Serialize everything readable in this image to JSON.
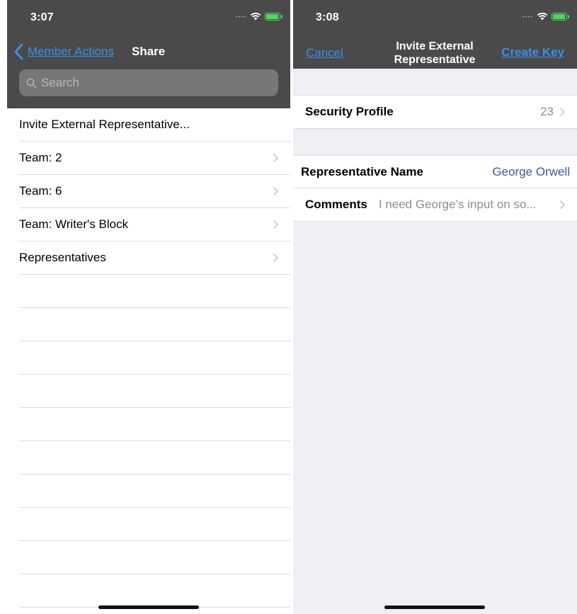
{
  "left": {
    "status_time": "3:07",
    "nav": {
      "back_label": "Member Actions",
      "title": "Share"
    },
    "search": {
      "placeholder": "Search"
    },
    "rows": [
      {
        "label": "Invite External Representative...",
        "has_chevron": false
      },
      {
        "label": "Team: 2",
        "has_chevron": true
      },
      {
        "label": "Team: 6",
        "has_chevron": true
      },
      {
        "label": "Team: Writer's Block",
        "has_chevron": true
      },
      {
        "label": "Representatives",
        "has_chevron": true
      }
    ]
  },
  "right": {
    "status_time": "3:08",
    "nav": {
      "cancel_label": "Cancel",
      "title_line1": "Invite External",
      "title_line2": "Representative",
      "create_key_label": "Create Key"
    },
    "security_profile": {
      "label": "Security Profile",
      "value": "23"
    },
    "representative_name": {
      "label": "Representative Name",
      "value": "George Orwell"
    },
    "comments": {
      "label": "Comments",
      "value": "I need George’s input on so..."
    }
  },
  "colors": {
    "nav_background": "#4a4a4a",
    "link_blue": "#3b8ee8",
    "value_blue": "#3b5998",
    "battery_green": "#4cd964",
    "grouped_background": "#efeff4"
  },
  "battery_level": 0.85
}
